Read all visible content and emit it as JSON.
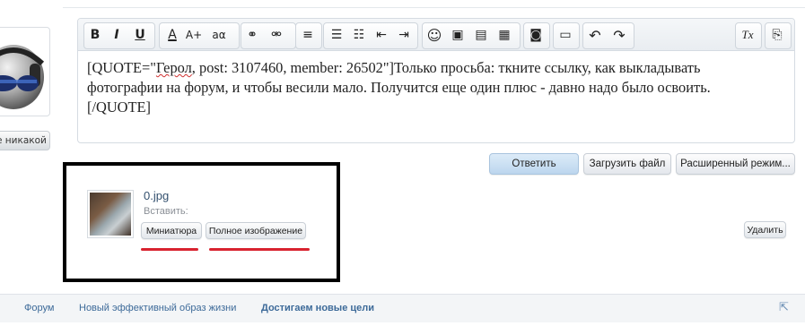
{
  "user": {
    "label": "е никакой"
  },
  "editor": {
    "toolbar": [
      {
        "name": "bold-icon",
        "glyph": "B"
      },
      {
        "name": "italic-icon",
        "glyph": "I"
      },
      {
        "name": "underline-icon",
        "glyph": "U"
      },
      {
        "name": "font-color-icon",
        "glyph": "A"
      },
      {
        "name": "font-size-up-icon",
        "glyph": "A+"
      },
      {
        "name": "font-size-down-icon",
        "glyph": "aα"
      },
      {
        "name": "link-icon",
        "glyph": "⚭"
      },
      {
        "name": "unlink-icon",
        "glyph": "⚮"
      },
      {
        "name": "align-icon",
        "glyph": "≡"
      },
      {
        "name": "bullet-list-icon",
        "glyph": "☰"
      },
      {
        "name": "numbered-list-icon",
        "glyph": "☷"
      },
      {
        "name": "outdent-icon",
        "glyph": "⇤"
      },
      {
        "name": "indent-icon",
        "glyph": "⇥"
      },
      {
        "name": "smiley-icon",
        "glyph": "☺"
      },
      {
        "name": "image-icon",
        "glyph": "▣"
      },
      {
        "name": "media-icon",
        "glyph": "▤"
      },
      {
        "name": "code-icon",
        "glyph": "▦"
      },
      {
        "name": "camera-icon",
        "glyph": "◙"
      },
      {
        "name": "save-draft-icon",
        "glyph": "▭"
      },
      {
        "name": "undo-icon",
        "glyph": "↶"
      },
      {
        "name": "redo-icon",
        "glyph": "↷"
      },
      {
        "name": "remove-format-icon",
        "glyph": "Tx"
      },
      {
        "name": "toggle-bbcode-icon",
        "glyph": "⎘"
      }
    ],
    "text_line1_before": "[QUOTE=\"",
    "text_line1_squig": "Герол",
    "text_line1_after": ", post: 3107460, member: 26502\"]Только просьба: ткните ссылку, как выкладывать",
    "text_line2": "фотографии на форум, и чтобы весили мало. Получится еще один плюс - давно надо было освоить.",
    "text_line3": "[/QUOTE]"
  },
  "actions": {
    "reply": "Ответить",
    "upload": "Загрузить файл",
    "advanced": "Расширенный режим..."
  },
  "attachment": {
    "filename": "0.jpg",
    "insert_label": "Вставить:",
    "thumbnail_button": "Миниатюра",
    "full_image_button": "Полное изображение",
    "delete_button": "Удалить"
  },
  "footer": {
    "crumbs": [
      "Форум",
      "Новый эффективный образ жизни",
      "Достигаем новые цели"
    ]
  },
  "colors": {
    "highlight": "#d8222f",
    "link": "#3d6a99",
    "frame": "#000000"
  }
}
